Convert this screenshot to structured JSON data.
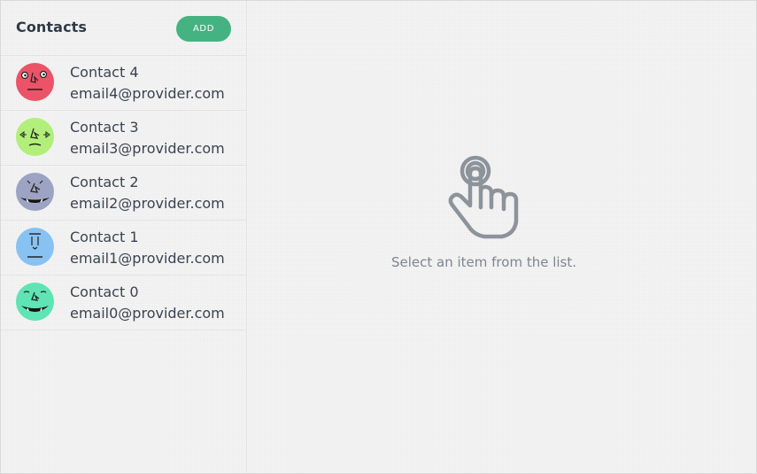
{
  "sidebar": {
    "title": "Contacts",
    "add_label": "ADD",
    "contacts": [
      {
        "name": "Contact 4",
        "email": "email4@provider.com",
        "avatar_color": "#ec5368"
      },
      {
        "name": "Contact 3",
        "email": "email3@provider.com",
        "avatar_color": "#b2ef7a"
      },
      {
        "name": "Contact 2",
        "email": "email2@provider.com",
        "avatar_color": "#9da3c2"
      },
      {
        "name": "Contact 1",
        "email": "email1@provider.com",
        "avatar_color": "#88c2f2"
      },
      {
        "name": "Contact 0",
        "email": "email0@provider.com",
        "avatar_color": "#5fe4b4"
      }
    ]
  },
  "main": {
    "empty_icon": "pointing-hand-icon",
    "empty_message": "Select an item from the list."
  },
  "colors": {
    "accent": "#45b281",
    "border": "#e2e2e2",
    "text": "#3a4350",
    "muted": "#7d858f"
  }
}
